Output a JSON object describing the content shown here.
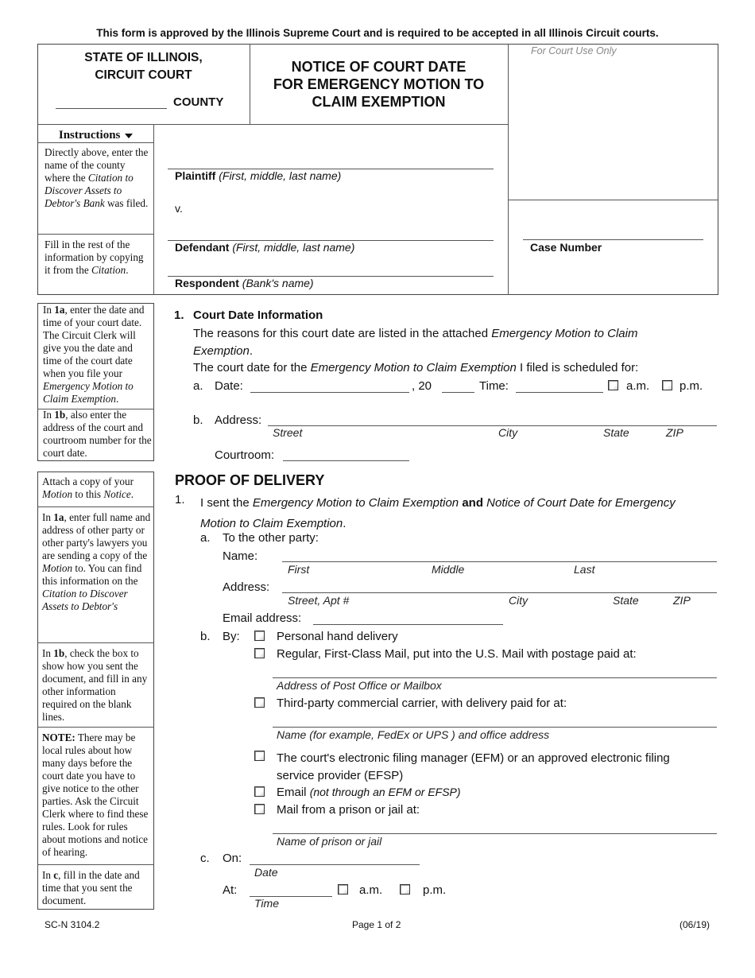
{
  "approval_notice": "This form is approved by the Illinois Supreme Court and is required to be accepted in all Illinois Circuit courts.",
  "header": {
    "state_line1": "STATE OF ILLINOIS,",
    "state_line2": "CIRCUIT COURT",
    "county_label": "COUNTY",
    "county_value": "",
    "title_line1": "NOTICE OF COURT DATE",
    "title_line2": "FOR EMERGENCY MOTION TO",
    "title_line3": "CLAIM EXEMPTION",
    "court_use_only": "For Court Use Only",
    "case_number_label": "Case Number",
    "case_number_value": ""
  },
  "parties": {
    "plaintiff_label": "Plaintiff",
    "plaintiff_hint": "(First, middle, last name)",
    "plaintiff_value": "",
    "versus": "v.",
    "defendant_label": "Defendant",
    "defendant_hint": "(First, middle, last name)",
    "defendant_value": "",
    "respondent_label": "Respondent",
    "respondent_hint": "(Bank's name)",
    "respondent_value": ""
  },
  "instructions": {
    "toggle_label": "Instructions",
    "toggle_icon": "caret-down-icon",
    "county": {
      "p1": "Directly above, enter the name of the county where the ",
      "italic": "Citation to Discover Assets to Debtor's Bank",
      "p2": " was filed."
    },
    "copy": {
      "p1": "Fill in the rest of the information by copying it from the ",
      "italic": "Citation",
      "p2": "."
    },
    "court_1a": {
      "p1": "In ",
      "bold": "1a",
      "p2": ", enter the date and time of your court date. The Circuit Clerk will give you the date and time of the court date when you file your ",
      "italic": "Emergency Motion to Claim Exemption",
      "p3": "."
    },
    "court_1b": {
      "p1": "In ",
      "bold": "1b",
      "p2": ", also enter the address of the court and courtroom number for the court date."
    },
    "attach": {
      "p1": "Attach a copy of your ",
      "italic1": "Motion",
      "p2": " to this ",
      "italic2": "Notice",
      "p3": "."
    },
    "proof_1a": {
      "p1": "In ",
      "bold": "1a",
      "p2": ", enter full name and address of other party or other party's lawyers you are sending a copy of the ",
      "italic1": "Motion",
      "p3": " to. You can find this information on the ",
      "italic2": "Citation to Discover Assets to Debtor's"
    },
    "proof_1b": {
      "p1": "In ",
      "bold": "1b",
      "p2": ", check the box to show how you sent the document, and fill in any other information required on the blank lines."
    },
    "note": {
      "bold": "NOTE:",
      "p1": " There may be local rules about how many days before the court date you have to give notice to the other parties. Ask the Circuit Clerk where to find these rules. Look for rules about motions and notice of hearing."
    },
    "proof_c": {
      "p1": "In ",
      "bold": "c",
      "p2": ", fill in the date and time that you sent the document."
    }
  },
  "court_date": {
    "number": "1.",
    "heading": "Court Date Information",
    "reasons_p1": "The reasons for this court date are listed in the attached ",
    "reasons_italic": "Emergency Motion to Claim Exemption",
    "reasons_p2": ".",
    "scheduled_p1": "The court date for the ",
    "scheduled_italic": "Emergency Motion to Claim Exemption",
    "scheduled_p2": " I filed is scheduled for:",
    "a_letter": "a.",
    "date_label": "Date:",
    "date_value": "",
    "year_prefix": ", 20",
    "year_value": "",
    "time_label": "Time:",
    "time_value": "",
    "am_label": "a.m.",
    "am_checked": false,
    "pm_label": "p.m.",
    "pm_checked": false,
    "b_letter": "b.",
    "address_label": "Address:",
    "address_value": "",
    "street_hint": "Street",
    "city_hint": "City",
    "state_hint": "State",
    "zip_hint": "ZIP",
    "courtroom_label": "Courtroom:",
    "courtroom_value": ""
  },
  "proof": {
    "heading": "PROOF OF DELIVERY",
    "number": "1.",
    "sent_p1": "I sent the ",
    "sent_italic1": "Emergency Motion to Claim Exemption",
    "sent_bold": "and",
    "sent_italic2a": "Notice of Court Date for Emergency",
    "sent_italic2b": "Motion to Claim Exemption",
    "sent_end": ".",
    "a_letter": "a.",
    "to_other_party": "To the other party:",
    "name_label": "Name:",
    "name_value": "",
    "first_hint": "First",
    "middle_hint": "Middle",
    "last_hint": "Last",
    "address_label": "Address:",
    "address_value": "",
    "street_apt_hint": "Street, Apt #",
    "city_hint": "City",
    "state_hint": "State",
    "zip_hint": "ZIP",
    "email_label": "Email address:",
    "email_value": "",
    "b_letter": "b.",
    "by_label": "By:",
    "methods": [
      {
        "label": "Personal hand delivery",
        "checked": false
      },
      {
        "label": "Regular, First-Class Mail, put into the U.S. Mail with postage paid at:",
        "checked": false,
        "line_hint": "Address of Post Office or Mailbox",
        "line_value": ""
      },
      {
        "label": "Third-party commercial carrier, with delivery paid for at:",
        "checked": false,
        "line_hint": "Name (for example, FedEx or UPS ) and office address",
        "line_value": ""
      },
      {
        "label_line1": "The court's electronic filing manager (EFM) or an approved electronic filing",
        "label_line2": "service provider (EFSP)",
        "checked": false
      },
      {
        "label": "Email",
        "label_hint": "(not through an EFM or EFSP)",
        "checked": false
      },
      {
        "label": "Mail from a prison or jail at:",
        "checked": false,
        "line_hint": "Name of prison or jail",
        "line_value": ""
      }
    ],
    "c_letter": "c.",
    "on_label": "On:",
    "date_value": "",
    "date_hint": "Date",
    "at_label": "At:",
    "time_value": "",
    "time_hint": "Time",
    "am_label": "a.m.",
    "am_checked": false,
    "pm_label": "p.m.",
    "pm_checked": false
  },
  "footer": {
    "form_code": "SC-N 3104.2",
    "page": "Page 1 of 2",
    "version": "(06/19)"
  }
}
